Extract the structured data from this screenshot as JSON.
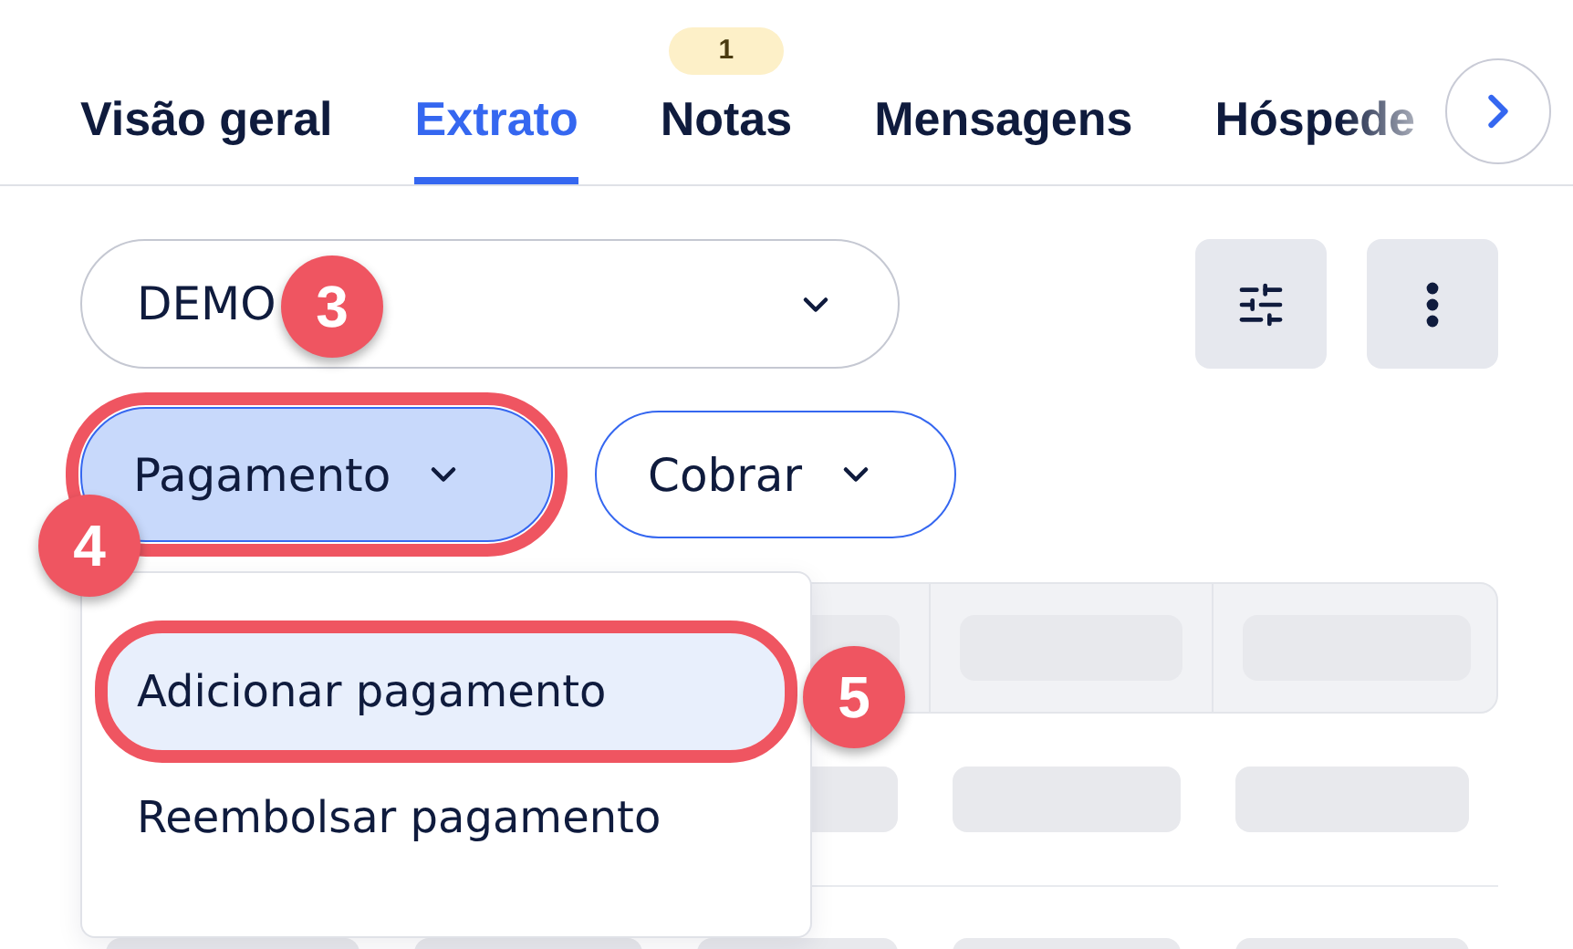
{
  "tabs": [
    {
      "label": "Visão geral",
      "selected": false
    },
    {
      "label": "Extrato",
      "selected": true
    },
    {
      "label": "Notas",
      "selected": false,
      "badge": "1"
    },
    {
      "label": "Mensagens",
      "selected": false
    },
    {
      "label": "Hóspede",
      "selected": false
    }
  ],
  "account_select": {
    "value": "DEMO"
  },
  "action_buttons": [
    {
      "label": "Pagamento",
      "kind": "primary",
      "highlighted": true
    },
    {
      "label": "Cobrar",
      "kind": "outline",
      "highlighted": false
    }
  ],
  "menu": {
    "items": [
      {
        "label": "Adicionar pagamento",
        "selected": true,
        "highlighted": true
      },
      {
        "label": "Reembolsar pagamento",
        "selected": false,
        "highlighted": false
      }
    ]
  },
  "annotations": [
    {
      "label": "3"
    },
    {
      "label": "4"
    },
    {
      "label": "5"
    }
  ]
}
